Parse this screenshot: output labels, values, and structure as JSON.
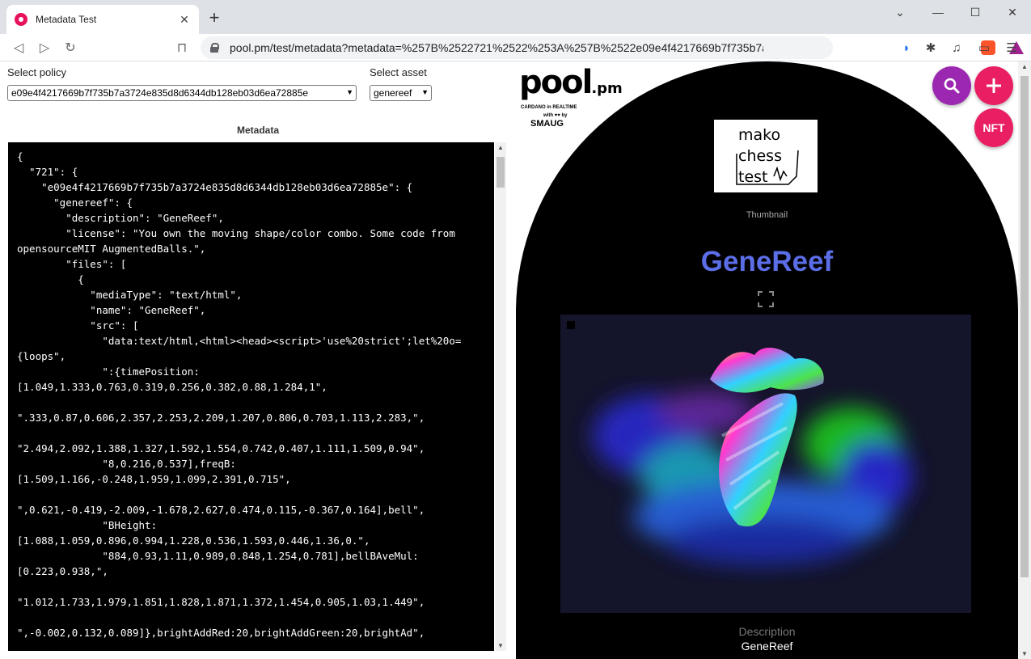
{
  "browser": {
    "tab_title": "Metadata Test",
    "url": "pool.pm/test/metadata?metadata=%257B%2522721%2522%253A%257B%2522e09e4f4217669b7f735b7a...",
    "new_tab_label": "+",
    "close_label": "✕",
    "minimize_label": "—",
    "maximize_label": "☐",
    "window_close_label": "✕"
  },
  "left": {
    "policy_label": "Select policy",
    "policy_value": "e09e4f4217669b7f735b7a3724e835d8d6344db128eb03d6ea72885e",
    "asset_label": "Select asset",
    "asset_value": "genereef",
    "metadata_heading": "Metadata",
    "code_lines": [
      "{",
      "  \"721\": {",
      "    \"e09e4f4217669b7f735b7a3724e835d8d6344db128eb03d6ea72885e\": {",
      "      \"genereef\": {",
      "        \"description\": \"GeneReef\",",
      "        \"license\": \"You own the moving shape/color combo. Some code from",
      "opensourceMIT AugmentedBalls.\",",
      "        \"files\": [",
      "          {",
      "            \"mediaType\": \"text/html\",",
      "            \"name\": \"GeneReef\",",
      "            \"src\": [",
      "              \"data:text/html,<html><head><script>'use%20strict';let%20o=",
      "{loops\",",
      "              \":{timePosition:",
      "[1.049,1.333,0.763,0.319,0.256,0.382,0.88,1.284,1\",",
      "",
      "\".333,0.87,0.606,2.357,2.253,2.209,1.207,0.806,0.703,1.113,2.283,\",",
      "",
      "\"2.494,2.092,1.388,1.327,1.592,1.554,0.742,0.407,1.111,1.509,0.94\",",
      "              \"8,0.216,0.537],freqB:",
      "[1.509,1.166,-0.248,1.959,1.099,2.391,0.715\",",
      "",
      "\",0.621,-0.419,-2.009,-1.678,2.627,0.474,0.115,-0.367,0.164],bell\",",
      "              \"BHeight:",
      "[1.088,1.059,0.896,0.994,1.228,0.536,1.593,0.446,1.36,0.\",",
      "              \"884,0.93,1.11,0.989,0.848,1.254,0.781],bellBAveMul:",
      "[0.223,0.938,\",",
      "",
      "\"1.012,1.733,1.979,1.851,1.828,1.871,1.372,1.454,0.905,1.03,1.449\",",
      "",
      "\",-0.002,0.132,0.089]},brightAddRed:20,brightAddGreen:20,brightAd\","
    ]
  },
  "right": {
    "logo_text": "pool",
    "logo_suffix": ".pm",
    "logo_tagline": "CARDANO in REALTIME",
    "logo_with": "with ♥♥ by",
    "logo_smaug": "SMAUG",
    "fab_nft": "NFT",
    "thumbnail_lines": [
      "mako",
      "chess",
      "test"
    ],
    "thumbnail_caption": "Thumbnail",
    "asset_title": "GeneReef",
    "description_label": "Description",
    "description_value": "GeneReef",
    "colors": {
      "title": "#5b6ee8",
      "search_fab": "#9c27b0",
      "add_fab": "#e91e63",
      "nft_fab": "#e91e63"
    }
  }
}
